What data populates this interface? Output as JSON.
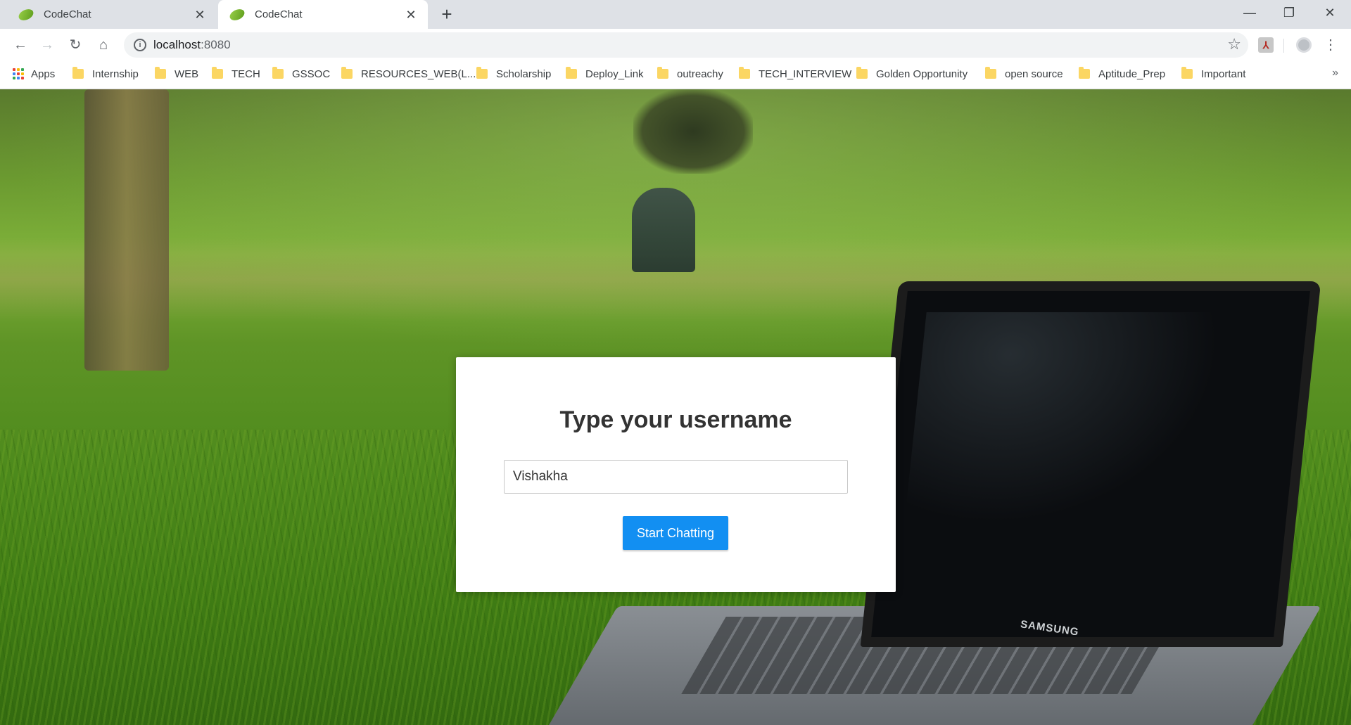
{
  "browser": {
    "tabs": [
      {
        "title": "CodeChat",
        "active": false
      },
      {
        "title": "CodeChat",
        "active": true
      }
    ],
    "new_tab_symbol": "+",
    "address": {
      "host": "localhost",
      "port": ":8080"
    },
    "bookmarks": [
      {
        "label": "Apps",
        "icon": "apps-grid-icon"
      },
      {
        "label": "Internship",
        "icon": "folder-icon"
      },
      {
        "label": "WEB",
        "icon": "folder-icon"
      },
      {
        "label": "TECH",
        "icon": "folder-icon"
      },
      {
        "label": "GSSOC",
        "icon": "folder-icon"
      },
      {
        "label": "RESOURCES_WEB(L...",
        "icon": "folder-icon"
      },
      {
        "label": "Scholarship",
        "icon": "folder-icon"
      },
      {
        "label": "Deploy_Link",
        "icon": "folder-icon"
      },
      {
        "label": "outreachy",
        "icon": "folder-icon"
      },
      {
        "label": "TECH_INTERVIEW",
        "icon": "folder-icon"
      },
      {
        "label": "Golden Opportunity",
        "icon": "folder-icon"
      },
      {
        "label": "open source",
        "icon": "folder-icon"
      },
      {
        "label": "Aptitude_Prep",
        "icon": "folder-icon"
      },
      {
        "label": "Important",
        "icon": "folder-icon"
      }
    ],
    "overflow_symbol": "»"
  },
  "page": {
    "heading": "Type your username",
    "username_value": "Vishakha",
    "submit_label": "Start Chatting",
    "laptop_brand": "SAMSUNG"
  },
  "colors": {
    "button_blue": "#128ff2",
    "tab_strip": "#dee1e6",
    "folder_yellow": "#fbd663"
  }
}
